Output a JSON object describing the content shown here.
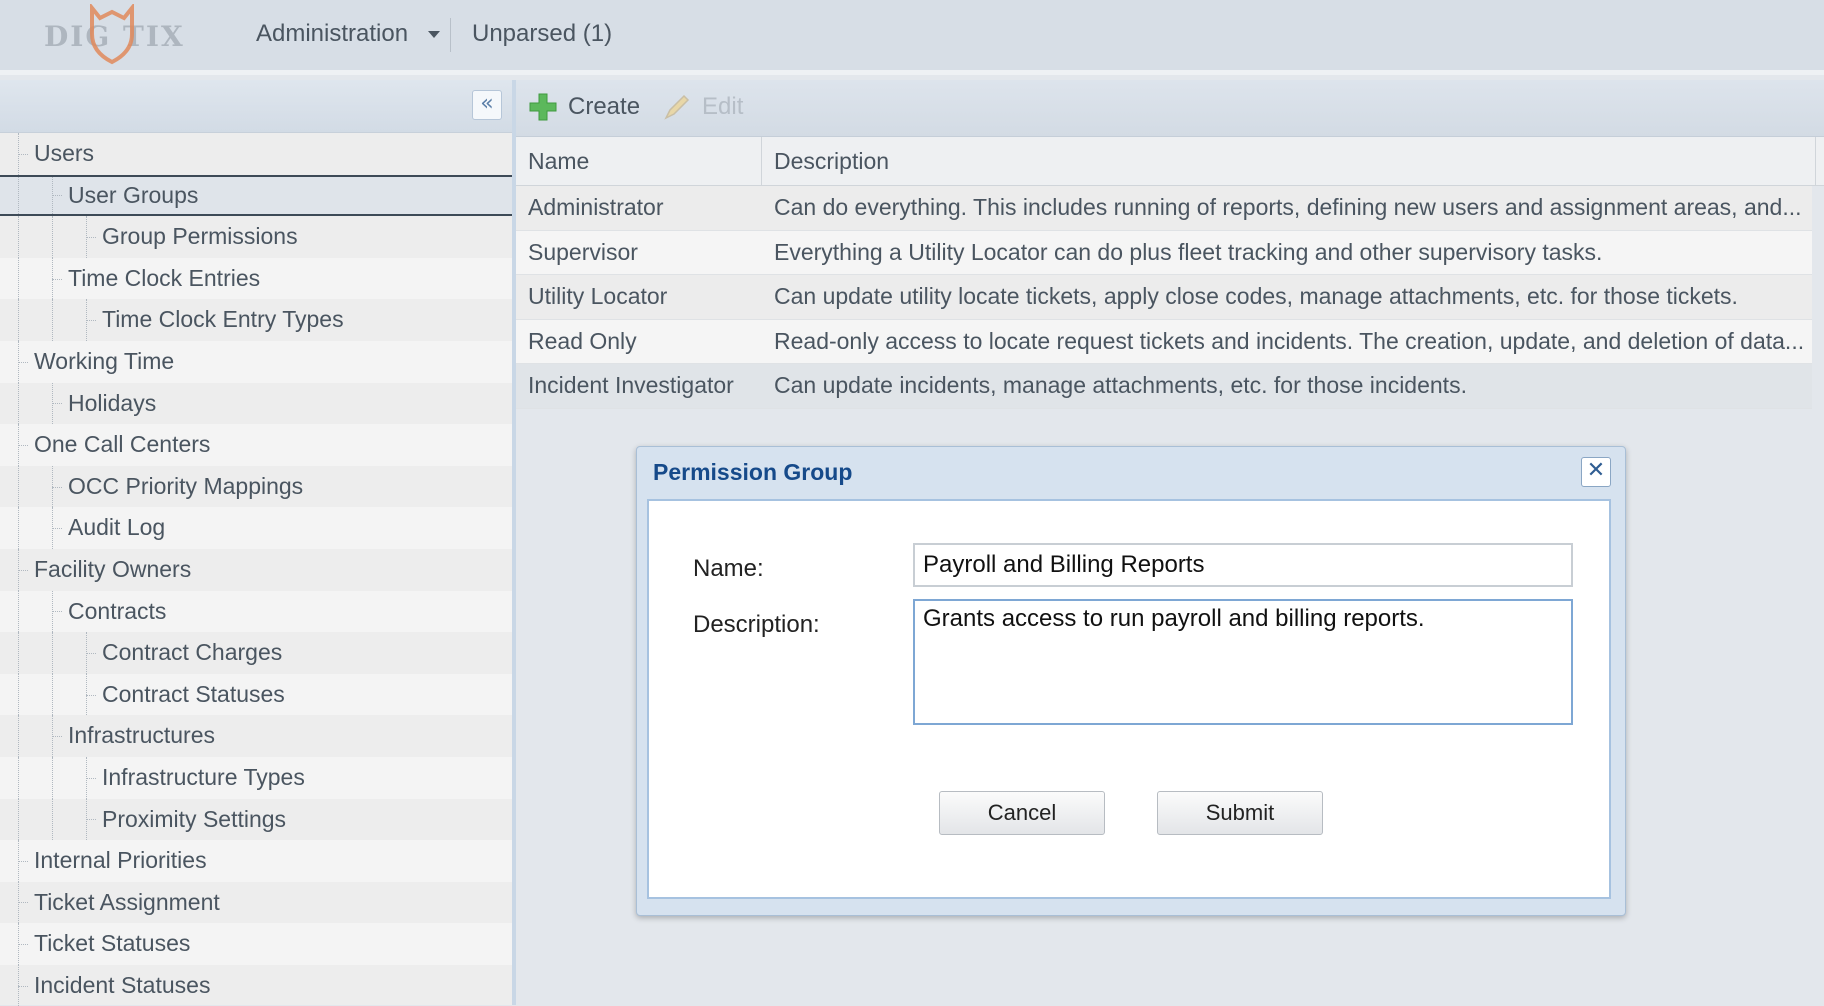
{
  "header": {
    "logo_text": "DIG TIX",
    "menu_admin": "Administration",
    "menu_unparsed": "Unparsed (1)"
  },
  "sidebar": {
    "collapse_glyph": "«",
    "items": [
      {
        "label": "Users",
        "level": 0
      },
      {
        "label": "User Groups",
        "level": 1,
        "selected": true
      },
      {
        "label": "Group Permissions",
        "level": 2
      },
      {
        "label": "Time Clock Entries",
        "level": 1
      },
      {
        "label": "Time Clock Entry Types",
        "level": 2
      },
      {
        "label": "Working Time",
        "level": 0
      },
      {
        "label": "Holidays",
        "level": 1
      },
      {
        "label": "One Call Centers",
        "level": 0
      },
      {
        "label": "OCC Priority Mappings",
        "level": 1
      },
      {
        "label": "Audit Log",
        "level": 1
      },
      {
        "label": "Facility Owners",
        "level": 0
      },
      {
        "label": "Contracts",
        "level": 1
      },
      {
        "label": "Contract Charges",
        "level": 2
      },
      {
        "label": "Contract Statuses",
        "level": 2
      },
      {
        "label": "Infrastructures",
        "level": 1
      },
      {
        "label": "Infrastructure Types",
        "level": 2
      },
      {
        "label": "Proximity Settings",
        "level": 2
      },
      {
        "label": "Internal Priorities",
        "level": 0
      },
      {
        "label": "Ticket Assignment",
        "level": 0
      },
      {
        "label": "Ticket Statuses",
        "level": 0
      },
      {
        "label": "Incident Statuses",
        "level": 0
      }
    ]
  },
  "toolbar": {
    "create_label": "Create",
    "edit_label": "Edit"
  },
  "grid": {
    "columns": [
      "Name",
      "Description"
    ],
    "rows": [
      {
        "name": "Administrator",
        "description": "Can do everything. This includes running of reports, defining new users and assignment areas, and..."
      },
      {
        "name": "Supervisor",
        "description": "Everything a Utility Locator can do plus fleet tracking and other supervisory tasks."
      },
      {
        "name": "Utility Locator",
        "description": "Can update utility locate tickets, apply close codes, manage attachments, etc. for those tickets."
      },
      {
        "name": "Read Only",
        "description": "Read-only access to locate request tickets and incidents. The creation, update, and deletion of data..."
      },
      {
        "name": "Incident Investigator",
        "description": "Can update incidents, manage attachments, etc. for those incidents."
      }
    ]
  },
  "dialog": {
    "title": "Permission Group",
    "close_glyph": "✕",
    "name_label": "Name:",
    "name_value": "Payroll and Billing Reports",
    "description_label": "Description:",
    "description_value": "Grants access to run payroll and billing reports.",
    "cancel_label": "Cancel",
    "submit_label": "Submit"
  },
  "colors": {
    "accent": "#164a8a",
    "create_icon": "#5cb85c",
    "logo_shield": "#e0895a"
  },
  "icons": {
    "create": "plus-icon",
    "edit": "pencil-icon",
    "collapse": "double-chevron-left-icon",
    "close": "close-icon",
    "logo": "shield-icon"
  }
}
